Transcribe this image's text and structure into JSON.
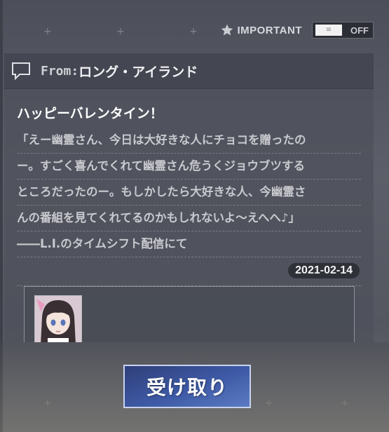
{
  "top_bar": {
    "important_label": "IMPORTANT",
    "toggle_state": "OFF"
  },
  "mail": {
    "from_label": "From:",
    "from_name": "ロング・アイランド",
    "title": "ハッピーバレンタイン！",
    "lines": [
      "「えー幽霊さん、今日は大好きな人にチョコを贈ったの",
      "ー。すごく喜んでくれて幽霊さん危うくジョウブツする",
      "ところだったのー。もしかしたら大好きな人、今幽霊さ",
      "んの番組を見てくれてるのかもしれないよ～えへへ♪」",
      "――L.I.のタイムシフト配信にて"
    ],
    "date": "2021-02-14"
  },
  "receive_button": {
    "label": "受け取り"
  },
  "colors": {
    "accent": "#3e5aa6",
    "card_header": "#444752",
    "badge_bg": "#2f3138"
  }
}
